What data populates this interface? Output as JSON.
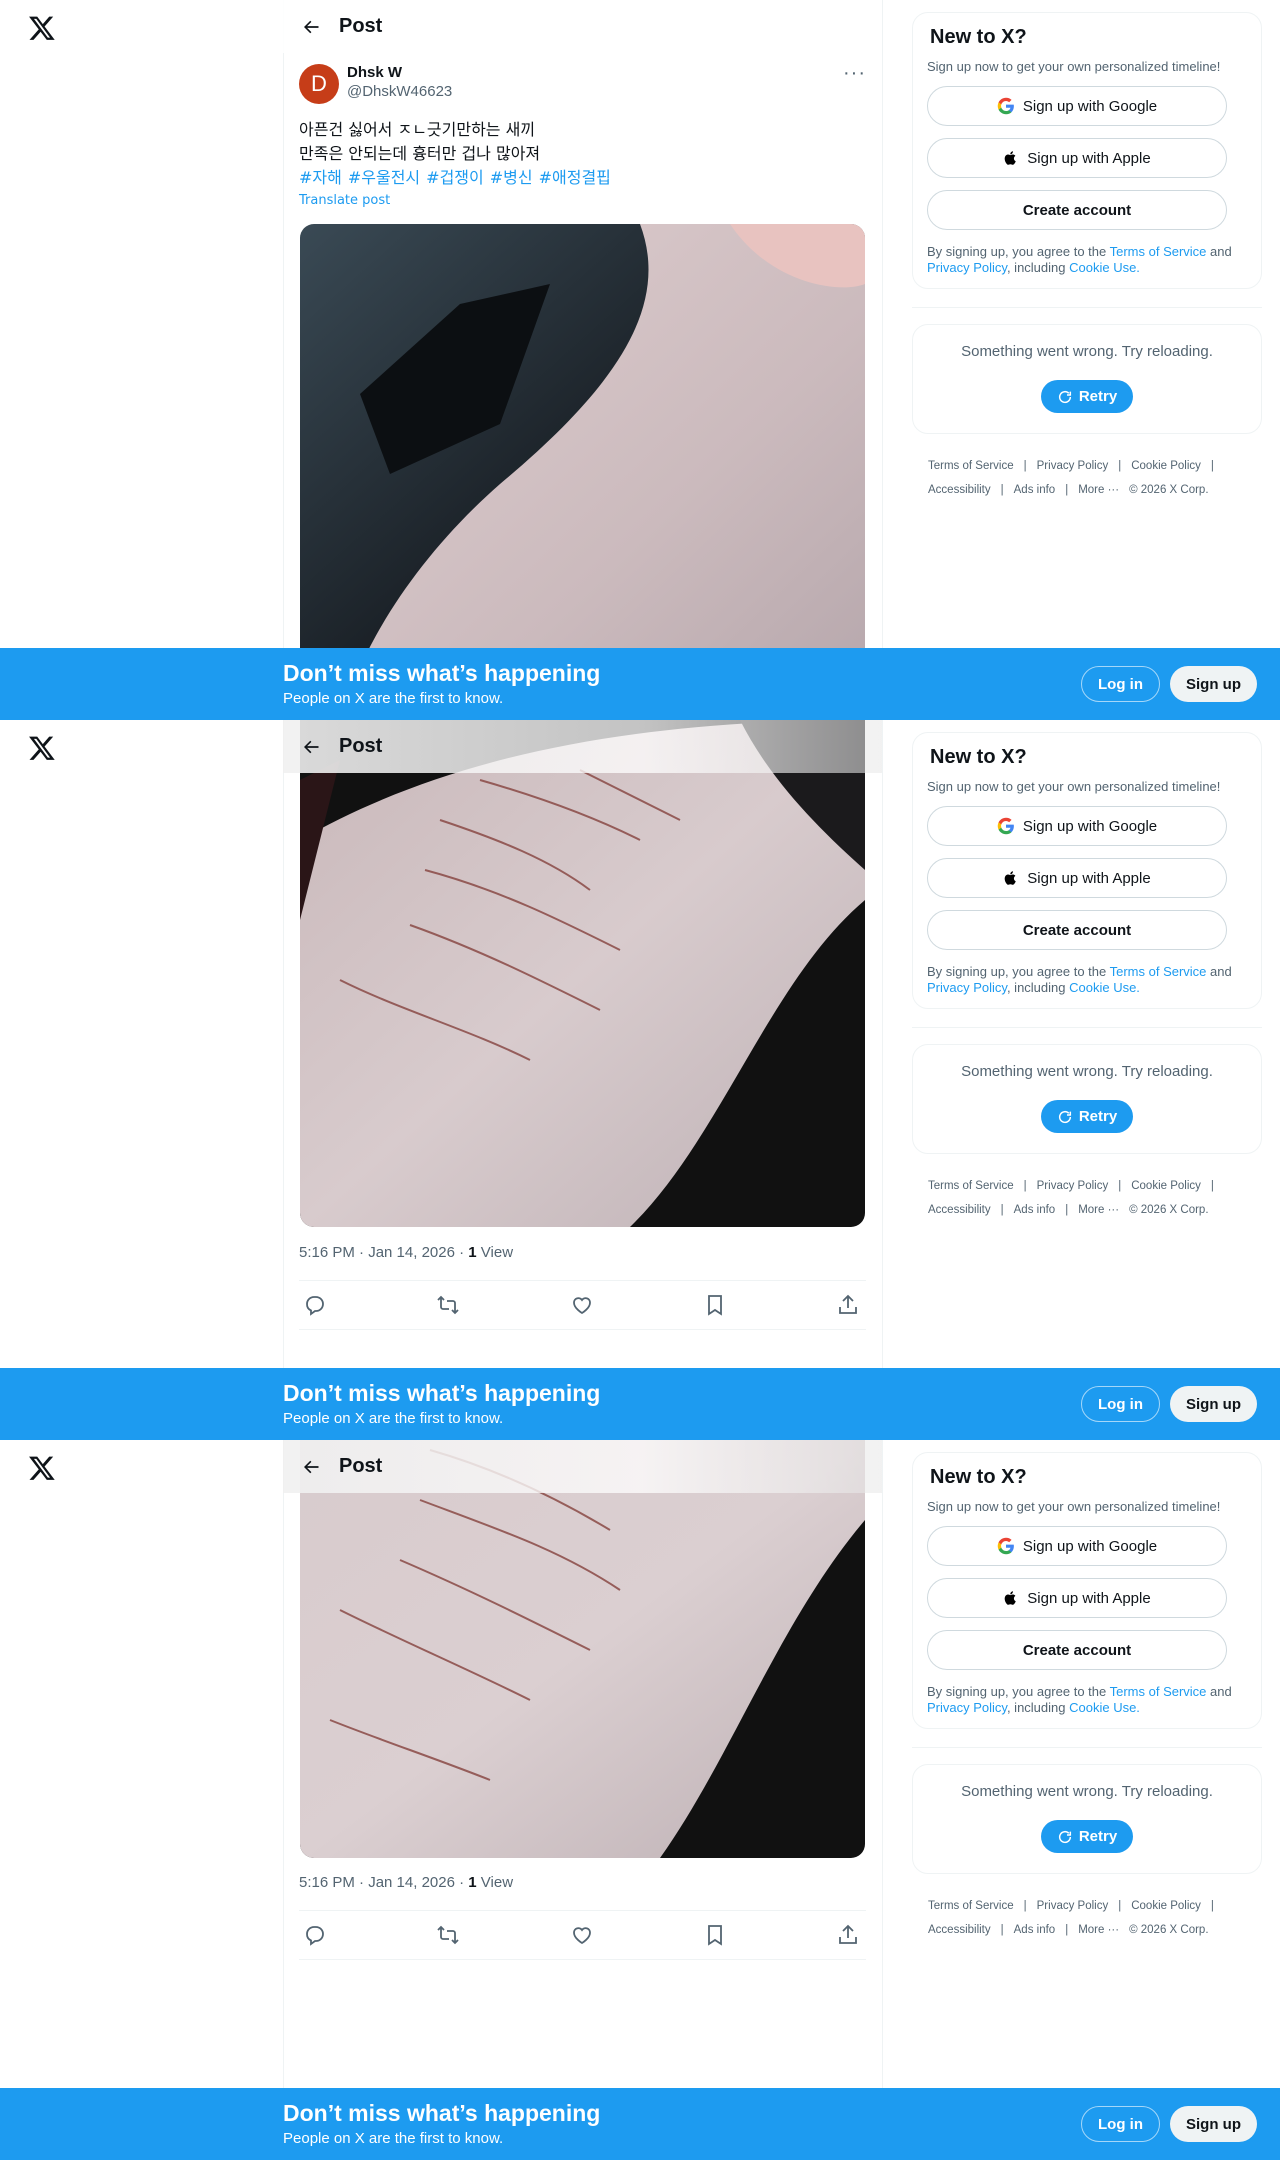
{
  "header": {
    "title": "Post"
  },
  "post": {
    "display_name": "Dhsk W",
    "handle": "@DhskW46623",
    "avatar_initial": "D",
    "line1": "아픈건 싫어서 ㅈㄴ긋기만하는 새끼",
    "line2": "만족은 안되는데 흉터만 겁나 많아져",
    "hashtags": [
      "#자해",
      "#우울전시",
      "#겁쟁이",
      "#병신",
      "#애정결핍"
    ],
    "translate": "Translate post",
    "timestamp": "5:16 PM · Jan 14, 2026 · ",
    "views_count": "1",
    "views_label": "View"
  },
  "sidebar": {
    "title": "New to X?",
    "subtitle": "Sign up now to get your own personalized timeline!",
    "google": "Sign up with Google",
    "apple": "Sign up with Apple",
    "create": "Create account",
    "terms_pre": "By signing up, you agree to the ",
    "terms_link": "Terms of Service",
    "terms_and": " and ",
    "privacy_link": "Privacy Policy",
    "terms_mid": ", including ",
    "cookie_link": "Cookie Use.",
    "error": "Something went wrong. Try reloading.",
    "retry": "Retry"
  },
  "footer": {
    "terms": "Terms of Service",
    "privacy": "Privacy Policy",
    "cookie": "Cookie Policy",
    "accessibility": "Accessibility",
    "ads": "Ads info",
    "more": "More ···",
    "copyright": "© 2026 X Corp.",
    "sep": "|"
  },
  "banner": {
    "title": "Don’t miss what’s happening",
    "subtitle": "People on X are the first to know.",
    "login": "Log in",
    "signup": "Sign up"
  },
  "colors": {
    "accent": "#1d9bf0",
    "avatar": "#c63d18"
  }
}
